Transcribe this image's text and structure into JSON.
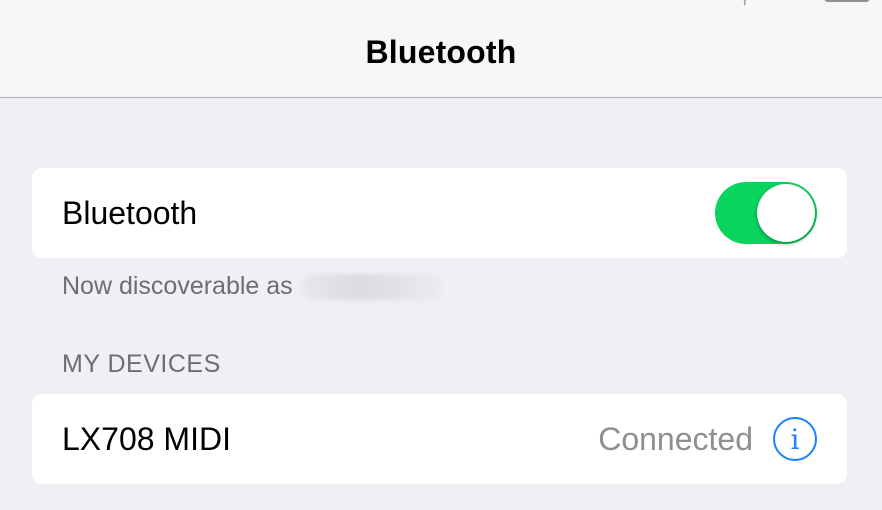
{
  "nav": {
    "title": "Bluetooth"
  },
  "bluetooth_toggle": {
    "label": "Bluetooth",
    "on": true,
    "on_color": "#09d45e"
  },
  "discoverable": {
    "text": "Now discoverable as"
  },
  "my_devices": {
    "header": "MY DEVICES",
    "devices": [
      {
        "name": "LX708 MIDI",
        "status": "Connected",
        "info_icon": "info-icon"
      }
    ]
  },
  "colors": {
    "accent": "#1a82fb",
    "background": "#efeff4",
    "secondary_text": "#8e8e93"
  }
}
